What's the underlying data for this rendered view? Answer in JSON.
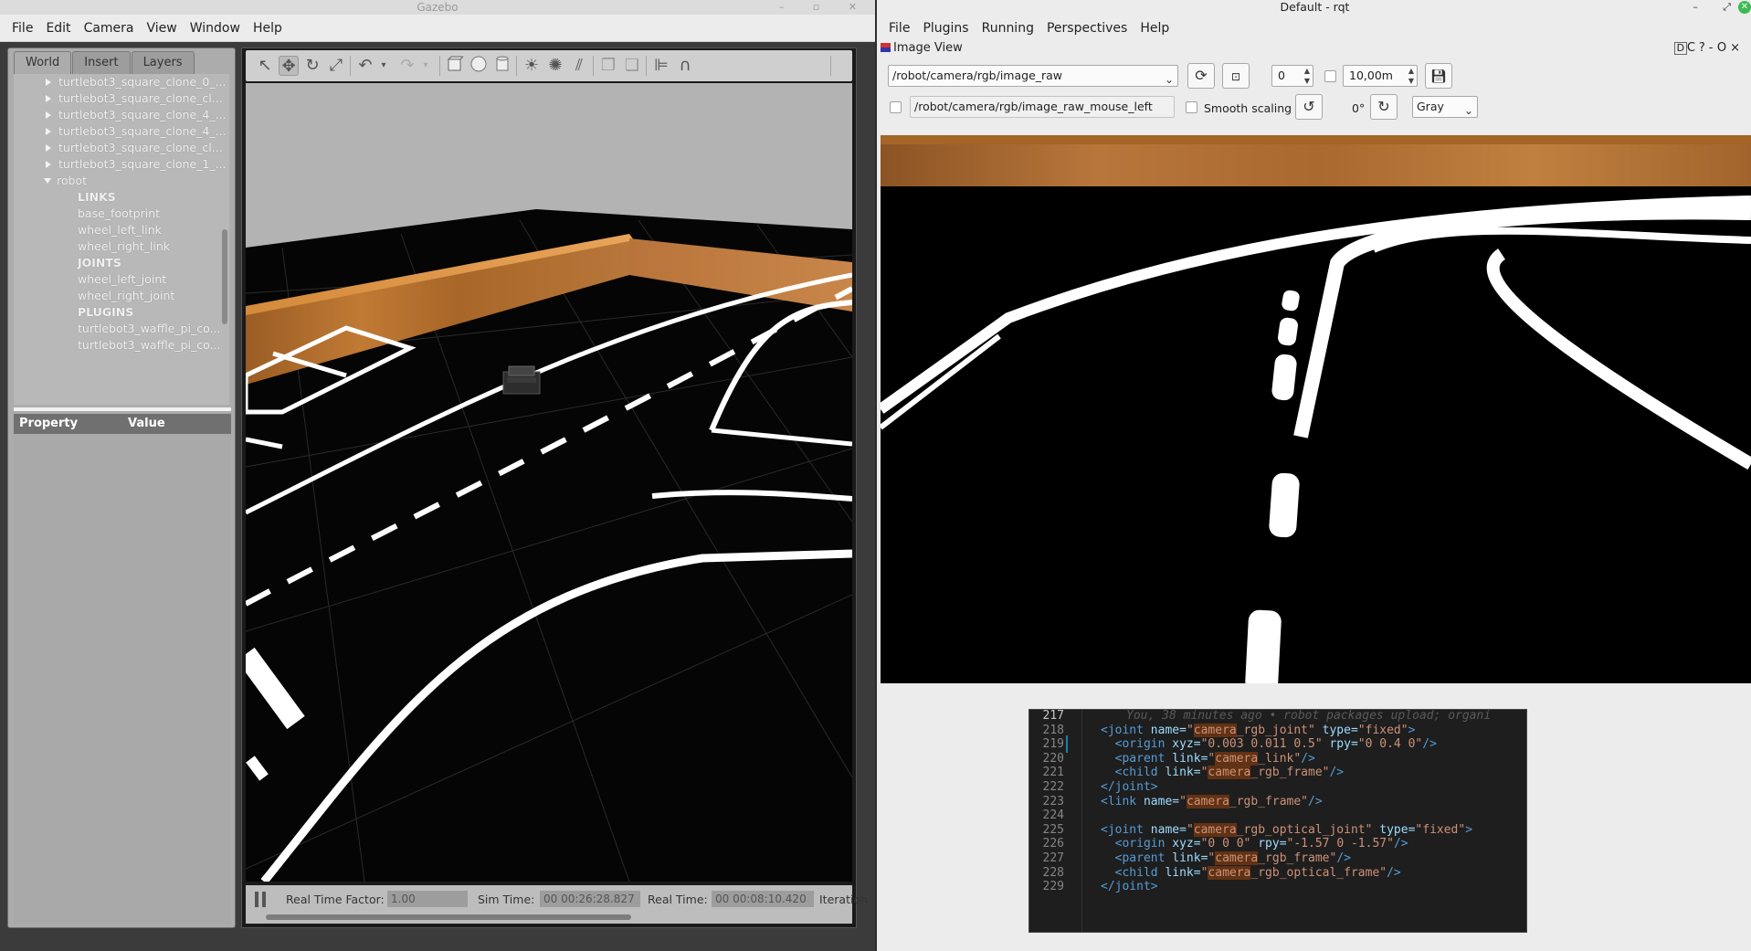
{
  "gazebo": {
    "title": "Gazebo",
    "menu": [
      "File",
      "Edit",
      "Camera",
      "View",
      "Window",
      "Help"
    ],
    "tabs": [
      "World",
      "Insert",
      "Layers"
    ],
    "active_tab": "World",
    "tree": [
      {
        "label": "turtlebot3_square_clone_0_...",
        "type": "collapsed"
      },
      {
        "label": "turtlebot3_square_clone_cl...",
        "type": "collapsed"
      },
      {
        "label": "turtlebot3_square_clone_4_...",
        "type": "collapsed"
      },
      {
        "label": "turtlebot3_square_clone_4_...",
        "type": "collapsed"
      },
      {
        "label": "turtlebot3_square_clone_cl...",
        "type": "collapsed"
      },
      {
        "label": "turtlebot3_square_clone_1_...",
        "type": "collapsed"
      },
      {
        "label": "robot",
        "type": "expanded"
      },
      {
        "label": "LINKS",
        "type": "section"
      },
      {
        "label": "base_footprint",
        "type": "leaf"
      },
      {
        "label": "wheel_left_link",
        "type": "leaf"
      },
      {
        "label": "wheel_right_link",
        "type": "leaf"
      },
      {
        "label": "JOINTS",
        "type": "section"
      },
      {
        "label": "wheel_left_joint",
        "type": "leaf"
      },
      {
        "label": "wheel_right_joint",
        "type": "leaf"
      },
      {
        "label": "PLUGINS",
        "type": "section"
      },
      {
        "label": "turtlebot3_waffle_pi_co...",
        "type": "leaf"
      },
      {
        "label": "turtlebot3_waffle_pi_co...",
        "type": "leaf"
      }
    ],
    "property_header": {
      "property": "Property",
      "value": "Value"
    },
    "toolbar_icons": [
      "select-arrow-icon",
      "translate-icon",
      "rotate-icon",
      "scale-icon",
      "undo-icon",
      "undo-dropdown-icon",
      "redo-icon",
      "redo-dropdown-icon",
      "box-icon",
      "sphere-icon",
      "cylinder-icon",
      "point-light-icon",
      "spot-light-icon",
      "directional-light-icon",
      "copy-icon",
      "paste-icon",
      "align-icon",
      "snap-icon"
    ],
    "status": {
      "rtf_label": "Real Time Factor:",
      "rtf_value": "1.00",
      "sim_label": "Sim Time:",
      "sim_value": "00 00:26:28.827",
      "real_label": "Real Time:",
      "real_value": "00 00:08:10.420",
      "iter_label": "Iteration"
    }
  },
  "rqt": {
    "title": "Default - rqt",
    "menu": [
      "File",
      "Plugins",
      "Running",
      "Perspectives",
      "Help"
    ],
    "plugin_title": "Image View",
    "plugin_right_controls": [
      "D",
      "C",
      "?",
      "-",
      "O",
      "×"
    ],
    "topic": "/robot/camera/rgb/image_raw",
    "spin_value": "0",
    "max_value": "10,00m",
    "mouse_topic": "/robot/camera/rgb/image_raw_mouse_left",
    "smooth_label": "Smooth scaling",
    "rotation": "0°",
    "color_scheme": "Gray"
  },
  "editor": {
    "lines": [
      {
        "n": "217",
        "current": true,
        "blame": "You, 38 minutes ago • robot packages upload; organi"
      },
      {
        "n": "218",
        "xml": [
          [
            "t",
            "<joint "
          ],
          [
            "a",
            "name="
          ],
          [
            "s",
            "\""
          ],
          [
            "h",
            "camera"
          ],
          [
            "s",
            "_rgb_joint\" "
          ],
          [
            "a",
            "type="
          ],
          [
            "s",
            "\"fixed\""
          ],
          [
            "t",
            ">"
          ]
        ]
      },
      {
        "n": "219",
        "git": true,
        "xml": [
          [
            "t",
            "  <origin "
          ],
          [
            "a",
            "xyz="
          ],
          [
            "s",
            "\"0.003 0.011 0.5\" "
          ],
          [
            "a",
            "rpy="
          ],
          [
            "s",
            "\"0 0.4 0\""
          ],
          [
            "t",
            "/>"
          ]
        ]
      },
      {
        "n": "220",
        "xml": [
          [
            "t",
            "  <parent "
          ],
          [
            "a",
            "link="
          ],
          [
            "s",
            "\""
          ],
          [
            "h",
            "camera"
          ],
          [
            "s",
            "_link\""
          ],
          [
            "t",
            "/>"
          ]
        ]
      },
      {
        "n": "221",
        "xml": [
          [
            "t",
            "  <child "
          ],
          [
            "a",
            "link="
          ],
          [
            "s",
            "\""
          ],
          [
            "h",
            "camera"
          ],
          [
            "s",
            "_rgb_frame\""
          ],
          [
            "t",
            "/>"
          ]
        ]
      },
      {
        "n": "222",
        "xml": [
          [
            "t",
            "</joint>"
          ]
        ]
      },
      {
        "n": "223",
        "xml": [
          [
            "t",
            "<link "
          ],
          [
            "a",
            "name="
          ],
          [
            "s",
            "\""
          ],
          [
            "h",
            "camera"
          ],
          [
            "s",
            "_rgb_frame\""
          ],
          [
            "t",
            "/>"
          ]
        ]
      },
      {
        "n": "224",
        "xml": []
      },
      {
        "n": "225",
        "xml": [
          [
            "t",
            "<joint "
          ],
          [
            "a",
            "name="
          ],
          [
            "s",
            "\""
          ],
          [
            "h",
            "camera"
          ],
          [
            "s",
            "_rgb_optical_joint\" "
          ],
          [
            "a",
            "type="
          ],
          [
            "s",
            "\"fixed\""
          ],
          [
            "t",
            ">"
          ]
        ]
      },
      {
        "n": "226",
        "xml": [
          [
            "t",
            "  <origin "
          ],
          [
            "a",
            "xyz="
          ],
          [
            "s",
            "\"0 0 0\" "
          ],
          [
            "a",
            "rpy="
          ],
          [
            "s",
            "\"-1.57 0 -1.57\""
          ],
          [
            "t",
            "/>"
          ]
        ]
      },
      {
        "n": "227",
        "xml": [
          [
            "t",
            "  <parent "
          ],
          [
            "a",
            "link="
          ],
          [
            "s",
            "\""
          ],
          [
            "h",
            "camera"
          ],
          [
            "s",
            "_rgb_frame\""
          ],
          [
            "t",
            "/>"
          ]
        ]
      },
      {
        "n": "228",
        "xml": [
          [
            "t",
            "  <child "
          ],
          [
            "a",
            "link="
          ],
          [
            "s",
            "\""
          ],
          [
            "h",
            "camera"
          ],
          [
            "s",
            "_rgb_optical_frame\""
          ],
          [
            "t",
            "/>"
          ]
        ]
      },
      {
        "n": "229",
        "xml": [
          [
            "t",
            "</joint>"
          ]
        ]
      }
    ]
  }
}
